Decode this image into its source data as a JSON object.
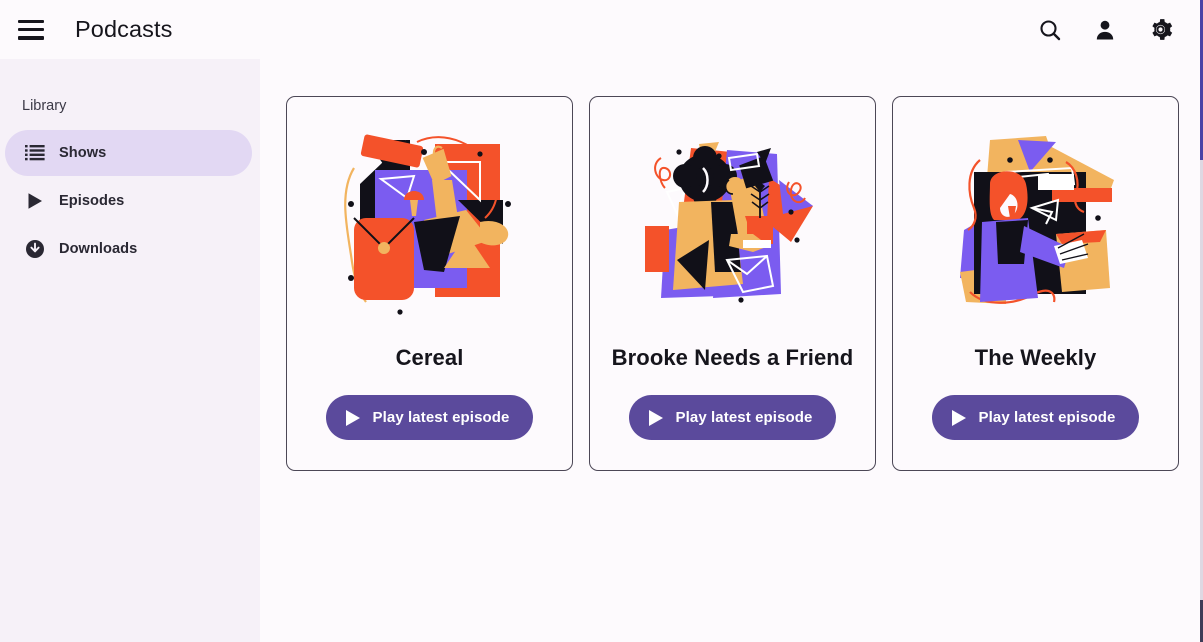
{
  "header": {
    "title": "Podcasts",
    "menu_icon": "hamburger-menu-icon",
    "actions": [
      {
        "name": "search-icon",
        "label": "Search"
      },
      {
        "name": "account-icon",
        "label": "Account"
      },
      {
        "name": "settings-gear-icon",
        "label": "Settings"
      }
    ]
  },
  "sidebar": {
    "title": "Library",
    "items": [
      {
        "label": "Shows",
        "icon": "list-icon",
        "selected": true
      },
      {
        "label": "Episodes",
        "icon": "play-icon",
        "selected": false
      },
      {
        "label": "Downloads",
        "icon": "download-icon",
        "selected": false
      }
    ]
  },
  "main": {
    "cards": [
      {
        "title": "Cereal",
        "button_label": "Play latest episode",
        "artwork": "abstract-podcast-art-1"
      },
      {
        "title": "Brooke Needs a Friend",
        "button_label": "Play latest episode",
        "artwork": "abstract-podcast-art-2"
      },
      {
        "title": "The Weekly",
        "button_label": "Play latest episode",
        "artwork": "abstract-podcast-art-3"
      }
    ]
  },
  "colors": {
    "page_background": "#fdfafd",
    "sidebar_background": "#f6f1f8",
    "selected_pill": "#e2d8f3",
    "accent_purple": "#5b4a9c",
    "text_primary": "#16151c",
    "card_border": "#4c4756",
    "art_orange": "#f4522a",
    "art_violet": "#7b5cf0",
    "art_tan": "#f2b45f",
    "art_black": "#111018"
  }
}
